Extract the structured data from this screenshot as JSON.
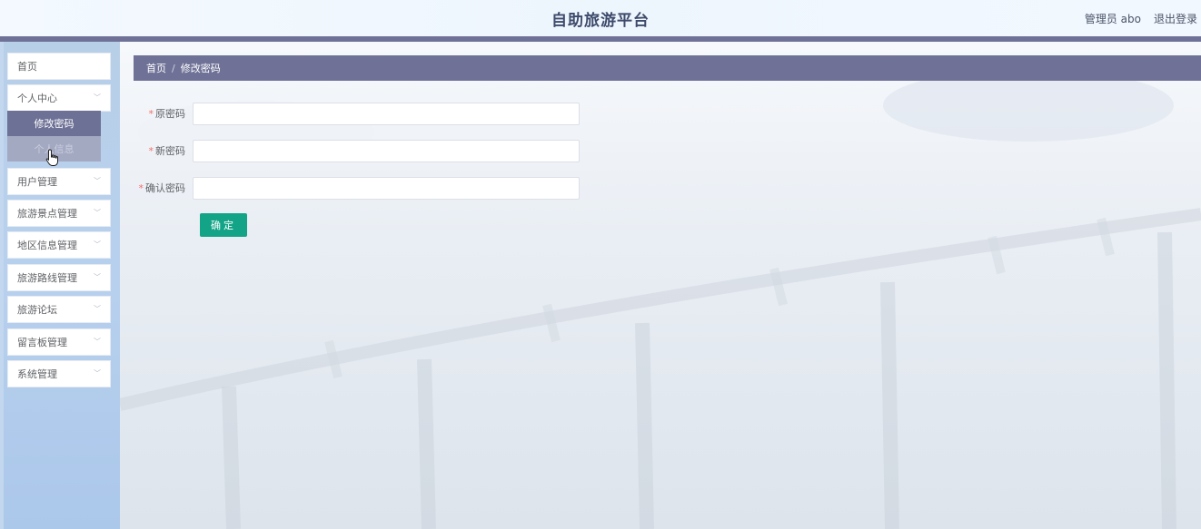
{
  "header": {
    "title": "自助旅游平台",
    "user_label": "管理员 abo",
    "logout_label": "退出登录"
  },
  "sidebar": {
    "items": [
      {
        "label": "首页"
      },
      {
        "label": "个人中心",
        "expanded": true,
        "children": [
          {
            "label": "修改密码",
            "active": true
          },
          {
            "label": "个人信息"
          }
        ]
      },
      {
        "label": "用户管理"
      },
      {
        "label": "旅游景点管理"
      },
      {
        "label": "地区信息管理"
      },
      {
        "label": "旅游路线管理"
      },
      {
        "label": "旅游论坛"
      },
      {
        "label": "留言板管理"
      },
      {
        "label": "系统管理"
      }
    ]
  },
  "breadcrumb": {
    "home": "首页",
    "separator": "/",
    "current": "修改密码"
  },
  "form": {
    "fields": [
      {
        "label": "原密码",
        "required": true,
        "value": ""
      },
      {
        "label": "新密码",
        "required": true,
        "value": ""
      },
      {
        "label": "确认密码",
        "required": true,
        "value": ""
      }
    ],
    "submit_label": "确定"
  },
  "colors": {
    "accent": "#6f7296",
    "submit": "#13a487",
    "required": "#f56c6c"
  }
}
